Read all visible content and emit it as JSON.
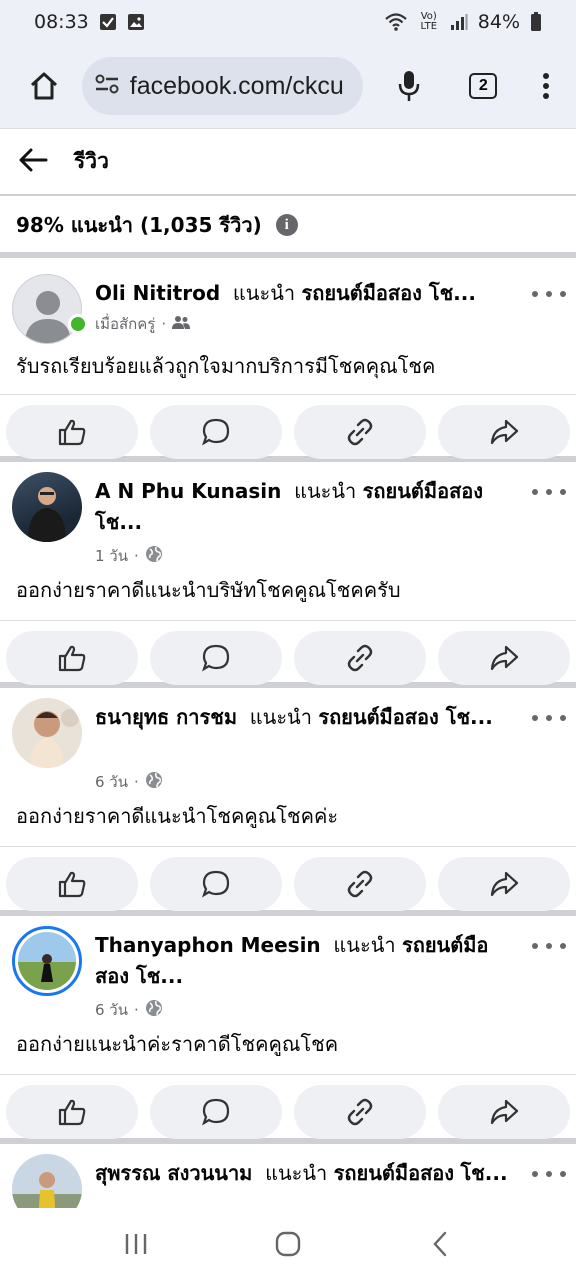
{
  "status": {
    "time": "08:33",
    "battery": "84%",
    "network": "Vo) LTE"
  },
  "browser": {
    "url": "facebook.com/ckcu",
    "tab_count": "2"
  },
  "page": {
    "title": "รีวิว",
    "summary": "98% แนะนำ (1,035 รีวิว)"
  },
  "reviews": [
    {
      "name": "Oli Nititrod",
      "verb": "แนะนำ",
      "page": "รถยนต์มือสอง โช...",
      "time": "เมื่อสักครู่",
      "privacy_icon": "friends-icon",
      "text": "รับรถเรียบร้อยแล้วถูกใจมากบริการมีโชคคุณโชค"
    },
    {
      "name": "A N Phu Kunasin",
      "verb": "แนะนำ",
      "page": "รถยนต์มือสอง โช...",
      "time": "1 วัน",
      "privacy_icon": "globe-icon",
      "text": "ออกง่ายราคาดีแนะนำบริษัทโชคคูณโชคครับ"
    },
    {
      "name": "ธนายุทธ การชม",
      "verb": "แนะนำ",
      "page": "รถยนต์มือสอง โช...",
      "time": "6 วัน",
      "privacy_icon": "globe-icon",
      "text": "ออกง่ายราคาดีแนะนำโชคคูณโชคค่ะ"
    },
    {
      "name": "Thanyaphon Meesin",
      "verb": "แนะนำ",
      "page": "รถยนต์มือสอง โช...",
      "time": "6 วัน",
      "privacy_icon": "globe-icon",
      "text": "ออกง่ายแนะนำค่ะราคาดีโชคคูณโชค"
    },
    {
      "name": "สุพรรณ สงวนนาม",
      "verb": "แนะนำ",
      "page": "รถยนต์มือสอง",
      "page_cut": "โช..."
    }
  ],
  "colors": {
    "accent": "#1877f2",
    "online": "#42b72a",
    "divider": "#ced0d4",
    "button_bg": "#eef0f3"
  }
}
